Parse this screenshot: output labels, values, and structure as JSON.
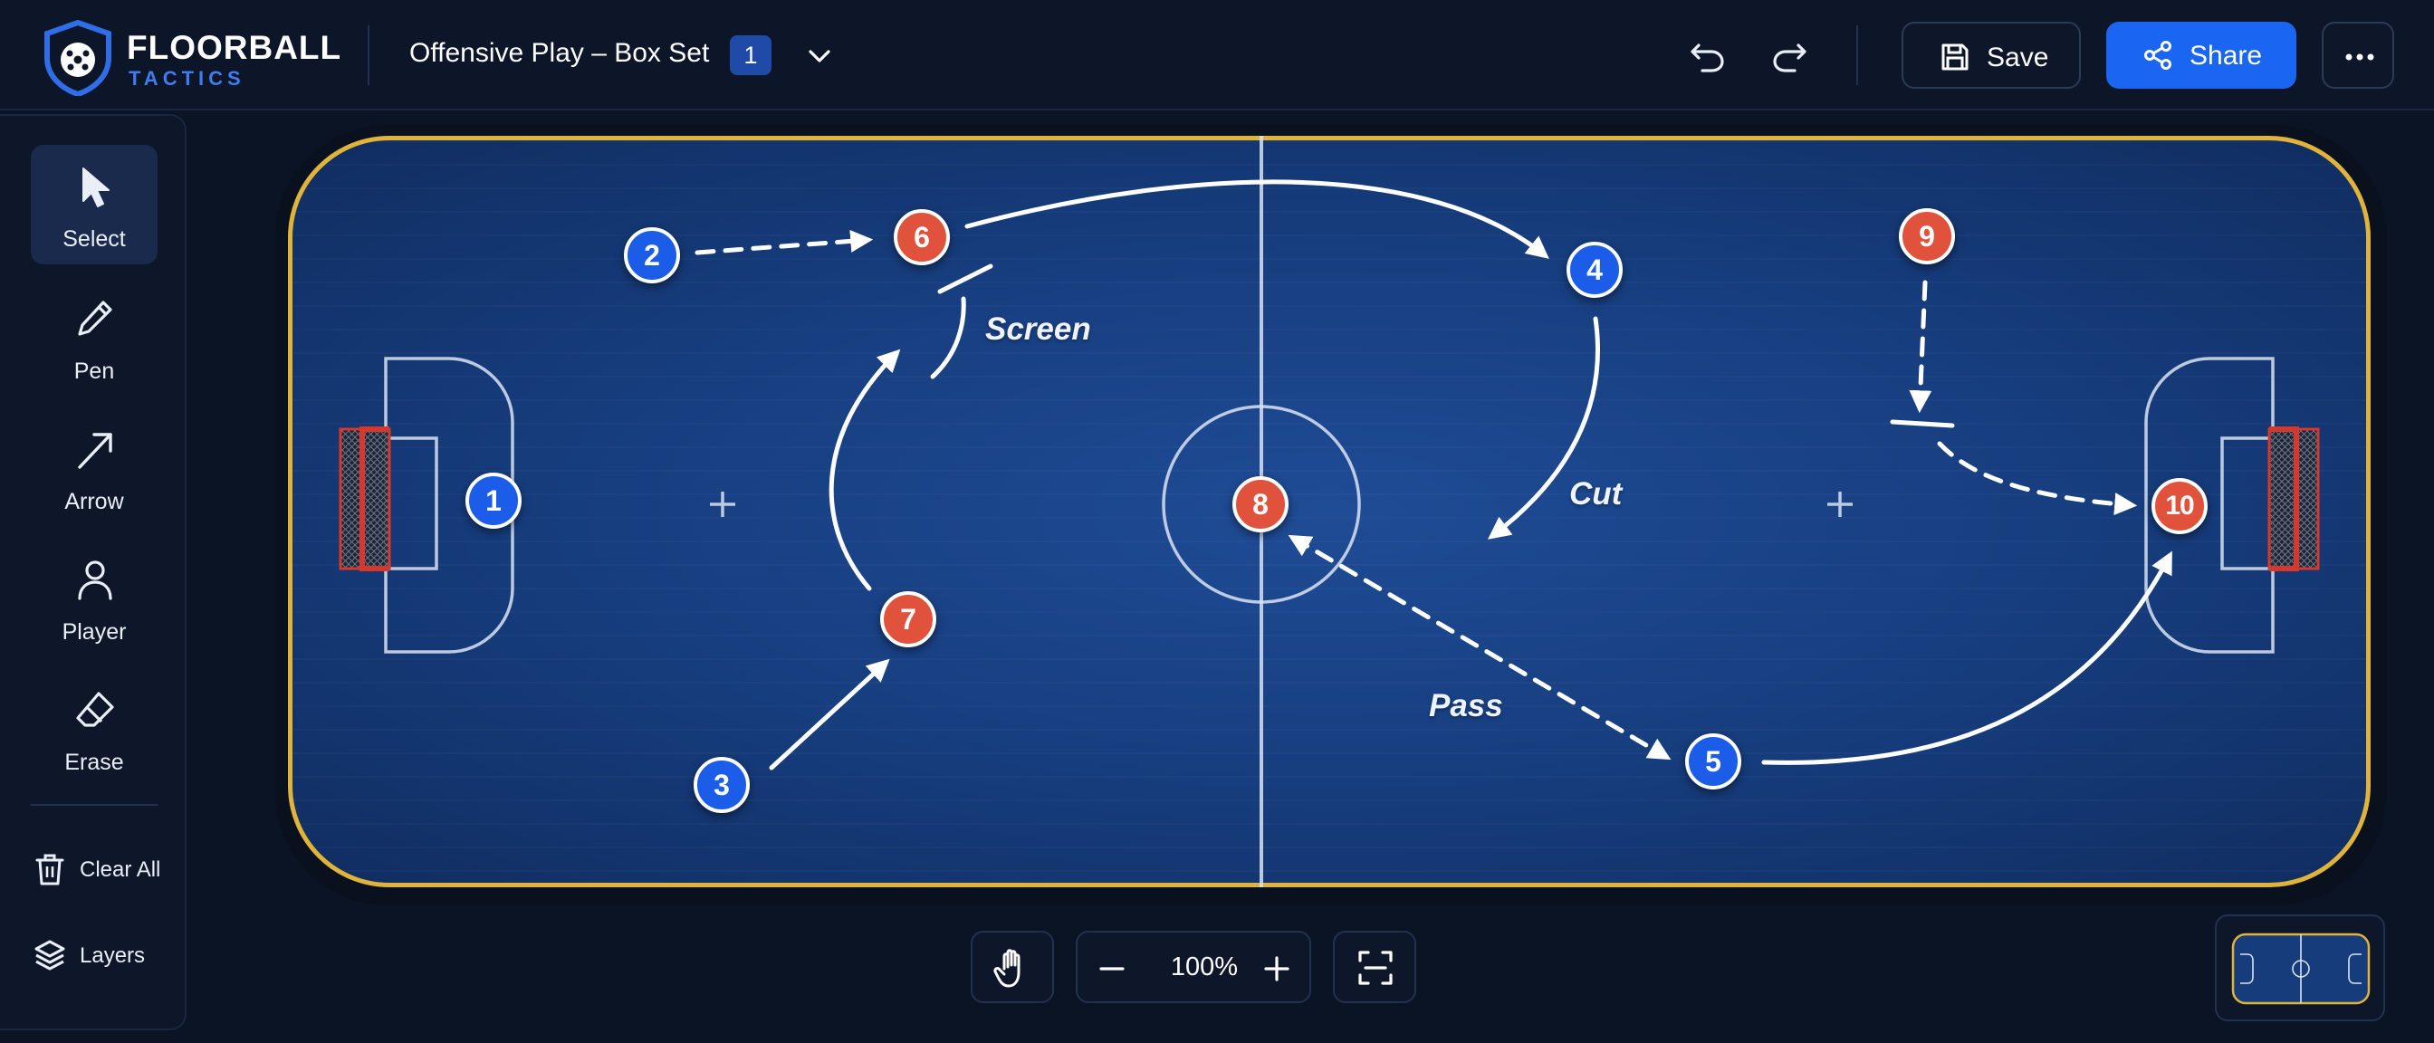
{
  "app": {
    "brand_line1": "FLOORBALL",
    "brand_line2": "TACTICS",
    "logo_icon": "floorball-shield-icon"
  },
  "header": {
    "doc_title": "Offensive Play – Box Set",
    "page_badge": "1",
    "save_label": "Save",
    "share_label": "Share",
    "icons": [
      "undo-icon",
      "redo-icon",
      "save-icon",
      "share-icon",
      "more-icon",
      "chevron-down-icon"
    ]
  },
  "tools": [
    {
      "label": "Select",
      "icon": "cursor-icon",
      "active": true
    },
    {
      "label": "Pen",
      "icon": "pen-icon",
      "active": false
    },
    {
      "label": "Arrow",
      "icon": "arrow-icon",
      "active": false
    },
    {
      "label": "Player",
      "icon": "player-icon",
      "active": false
    },
    {
      "label": "Erase",
      "icon": "eraser-icon",
      "active": false
    }
  ],
  "panel_actions": [
    {
      "label": "Clear All",
      "icon": "trash-icon"
    },
    {
      "label": "Layers",
      "icon": "layers-icon"
    }
  ],
  "board": {
    "players": [
      {
        "number": "1",
        "team": "blue"
      },
      {
        "number": "2",
        "team": "blue"
      },
      {
        "number": "3",
        "team": "blue"
      },
      {
        "number": "4",
        "team": "blue"
      },
      {
        "number": "5",
        "team": "blue"
      },
      {
        "number": "6",
        "team": "red"
      },
      {
        "number": "7",
        "team": "red"
      },
      {
        "number": "8",
        "team": "red"
      },
      {
        "number": "9",
        "team": "red"
      },
      {
        "number": "10",
        "team": "red"
      }
    ],
    "annotations": [
      "Screen",
      "Cut",
      "Pass"
    ]
  },
  "bottom_bar": {
    "zoom_level": "100%",
    "icons": [
      "hand-pan-icon",
      "zoom-out-icon",
      "zoom-in-icon",
      "fit-screen-icon",
      "minimap-icon"
    ]
  },
  "colors": {
    "accent": "#1a66f2",
    "team_blue": "#1b5de8",
    "team_red": "#e0523c",
    "rink_border": "#e0b43a",
    "rink_surface": "#163c7c",
    "background": "#0b1424"
  }
}
